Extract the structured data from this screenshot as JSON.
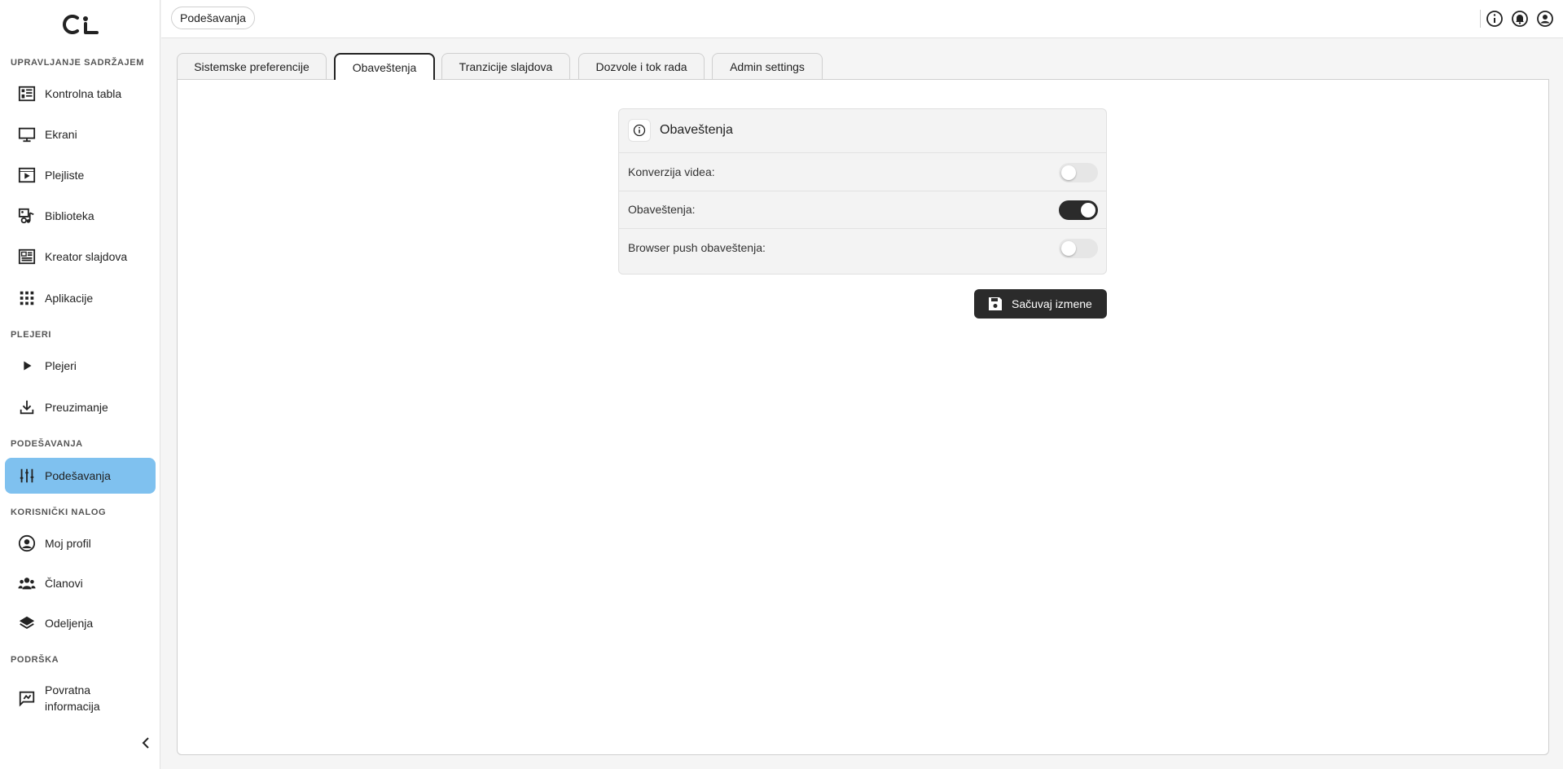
{
  "sidebar": {
    "logo_name": "app-logo",
    "sections": [
      {
        "title": "UPRAVLJANJE SADRŽAJEM"
      },
      {
        "title": "PLEJERI"
      },
      {
        "title": "PODEŠAVANJA"
      },
      {
        "title": "KORISNIČKI NALOG"
      },
      {
        "title": "PODRŠKA"
      }
    ],
    "items": [
      {
        "label": "Kontrolna tabla",
        "icon": "dashboard-icon"
      },
      {
        "label": "Ekrani",
        "icon": "monitor-icon"
      },
      {
        "label": "Plejliste",
        "icon": "playlist-icon"
      },
      {
        "label": "Biblioteka",
        "icon": "media-library-icon"
      },
      {
        "label": "Kreator slajdova",
        "icon": "slide-creator-icon"
      },
      {
        "label": "Aplikacije",
        "icon": "apps-grid-icon"
      },
      {
        "label": "Plejeri",
        "icon": "play-icon"
      },
      {
        "label": "Preuzimanje",
        "icon": "download-icon"
      },
      {
        "label": "Podešavanja",
        "icon": "sliders-icon",
        "active": true
      },
      {
        "label": "Moj profil",
        "icon": "user-circle-icon"
      },
      {
        "label": "Članovi",
        "icon": "users-icon"
      },
      {
        "label": "Odeljenja",
        "icon": "layers-icon"
      },
      {
        "label": "Povratna informacija",
        "icon": "feedback-icon"
      }
    ]
  },
  "header": {
    "breadcrumb": "Podešavanja",
    "icons": [
      "info-icon",
      "notifications-icon",
      "account-icon"
    ]
  },
  "tabs": [
    {
      "label": "Sistemske preferencije"
    },
    {
      "label": "Obaveštenja",
      "active": true
    },
    {
      "label": "Tranzicije slajdova"
    },
    {
      "label": "Dozvole i tok rada"
    },
    {
      "label": "Admin settings"
    }
  ],
  "card": {
    "title": "Obaveštenja",
    "rows": [
      {
        "label": "Konverzija videa:",
        "enabled": false
      },
      {
        "label": "Obaveštenja:",
        "enabled": true
      },
      {
        "label": "Browser push obaveštenja:",
        "enabled": false
      }
    ]
  },
  "save_button": {
    "label": "Sačuvaj izmene"
  },
  "colors": {
    "accent_active": "#7fc1ef",
    "dark": "#2b2b2b"
  }
}
